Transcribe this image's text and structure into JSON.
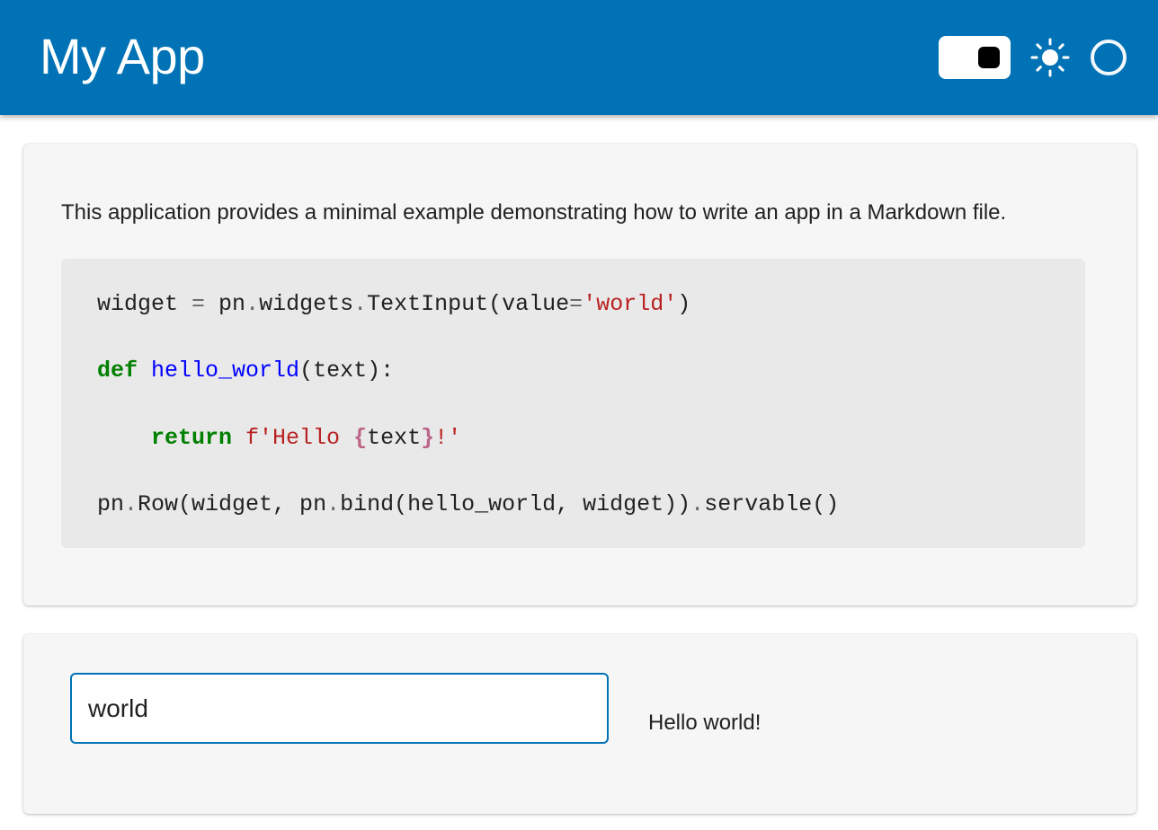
{
  "header": {
    "title": "My App",
    "bg_color": "#0072b5",
    "controls": {
      "theme_toggle": "toggle-switch",
      "theme_icon": "sun-icon",
      "status_icon": "busy-indicator-circle"
    }
  },
  "markdown": {
    "description": "This application provides a minimal example demonstrating how to write an app in a Markdown file.",
    "code": {
      "line1": {
        "a": "widget ",
        "b": "=",
        "c": " pn",
        "d": ".",
        "e": "widgets",
        "f": ".",
        "g": "TextInput(value",
        "h": "=",
        "i": "'world'",
        "j": ")"
      },
      "line2": {
        "kw": "def",
        "sp": " ",
        "fn": "hello_world",
        "rest": "(text):"
      },
      "line3": {
        "indent": "    ",
        "kw": "return",
        "sp": " ",
        "s1": "f'Hello ",
        "o1": "{",
        "var": "text",
        "o2": "}",
        "s2": "!'"
      },
      "line4": {
        "a": "pn",
        "b": ".",
        "c": "Row(widget, pn",
        "d": ".",
        "e": "bind(hello_world, widget))",
        "f": ".",
        "g": "servable()"
      }
    }
  },
  "app": {
    "input_value": "world",
    "output": "Hello world!"
  }
}
